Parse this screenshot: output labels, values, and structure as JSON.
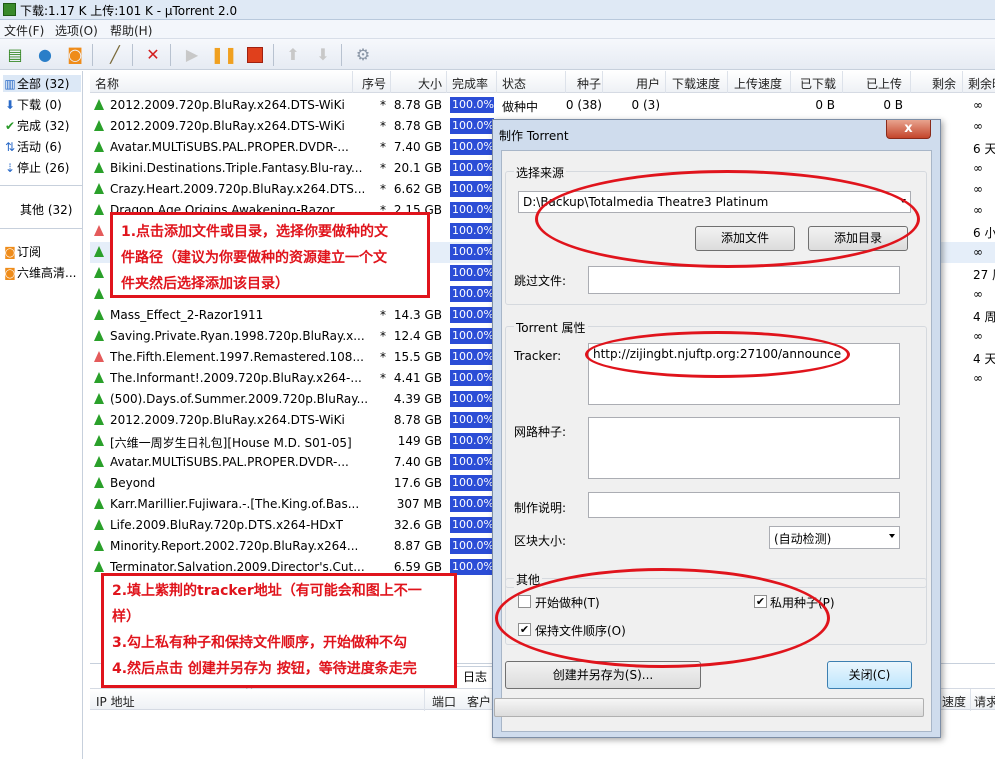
{
  "window": {
    "title": "下载:1.17 K 上传:101 K - µTorrent 2.0"
  },
  "menu": [
    "文件(F)",
    "选项(O)",
    "帮助(H)"
  ],
  "toolbar": {
    "icons": [
      "add-torrent-icon",
      "add-url-icon",
      "rss-icon",
      "create-torrent-icon",
      "remove-icon",
      "start-icon",
      "pause-icon",
      "stop-icon",
      "move-up-icon",
      "move-down-icon",
      "preferences-icon"
    ]
  },
  "sidebar": {
    "items": [
      {
        "label": "全部 (32)",
        "icon": "all-icon"
      },
      {
        "label": "下载 (0)",
        "icon": "download-icon"
      },
      {
        "label": "完成 (32)",
        "icon": "check-icon"
      },
      {
        "label": "活动 (6)",
        "icon": "active-icon"
      },
      {
        "label": "停止 (26)",
        "icon": "stopped-icon"
      }
    ],
    "other": "其他 (32)",
    "feeds": [
      {
        "label": "订阅",
        "icon": "rss-icon"
      },
      {
        "label": "六维高清...",
        "icon": "rss-icon"
      }
    ]
  },
  "columns": [
    "名称",
    "序号",
    "大小",
    "完成率",
    "状态",
    "种子",
    "用户",
    "下载速度",
    "上传速度",
    "已下载",
    "已上传",
    "剩余",
    "剩余时"
  ],
  "rows": [
    {
      "name": "2012.2009.720p.BluRay.x264.DTS-WiKi",
      "star": "*",
      "size": "8.78 GB",
      "pct": "100.0%",
      "status": "做种中",
      "seeds": "0 (38)",
      "peers": "0 (3)",
      "downloaded": "0 B",
      "uploaded": "0 B",
      "remain": "∞"
    },
    {
      "name": "2012.2009.720p.BluRay.x264.DTS-WiKi",
      "star": "*",
      "size": "8.78 GB",
      "pct": "100.0%",
      "remain": "∞"
    },
    {
      "name": "Avatar.MULTiSUBS.PAL.PROPER.DVDR-...",
      "star": "*",
      "size": "7.40 GB",
      "pct": "100.0%",
      "remain": "6 天"
    },
    {
      "name": "Bikini.Destinations.Triple.Fantasy.Blu-ray...",
      "star": "*",
      "size": "20.1 GB",
      "pct": "100.0%",
      "remain": "∞"
    },
    {
      "name": "Crazy.Heart.2009.720p.BluRay.x264.DTS...",
      "star": "*",
      "size": "6.62 GB",
      "pct": "100.0%",
      "remain": "∞"
    },
    {
      "name": "Dragon.Age.Origins.Awakening-Razor...",
      "star": "*",
      "size": "2.15 GB",
      "pct": "100.0%",
      "remain": "∞"
    },
    {
      "name": "",
      "star": "",
      "size": "",
      "pct": "100.0%",
      "remain": "6 小时"
    },
    {
      "name": "",
      "star": "",
      "size": "",
      "pct": "100.0%",
      "remain": "∞"
    },
    {
      "name": "",
      "star": "",
      "size": "",
      "pct": "100.0%",
      "remain": "27 周"
    },
    {
      "name": "",
      "star": "",
      "size": "",
      "pct": "100.0%",
      "remain": "∞"
    },
    {
      "name": "Mass_Effect_2-Razor1911",
      "star": "*",
      "size": "14.3 GB",
      "pct": "100.0%",
      "remain": "4 周"
    },
    {
      "name": "Saving.Private.Ryan.1998.720p.BluRay.x...",
      "star": "*",
      "size": "12.4 GB",
      "pct": "100.0%",
      "remain": "∞"
    },
    {
      "name": "The.Fifth.Element.1997.Remastered.108...",
      "star": "*",
      "size": "15.5 GB",
      "pct": "100.0%",
      "remain": "4 天"
    },
    {
      "name": "The.Informant!.2009.720p.BluRay.x264-...",
      "star": "*",
      "size": "4.41 GB",
      "pct": "100.0%",
      "remain": "∞"
    },
    {
      "name": "(500).Days.of.Summer.2009.720p.BluRay...",
      "star": "",
      "size": "4.39 GB",
      "pct": "100.0%",
      "remain": ""
    },
    {
      "name": "2012.2009.720p.BluRay.x264.DTS-WiKi",
      "star": "",
      "size": "8.78 GB",
      "pct": "100.0%",
      "remain": ""
    },
    {
      "name": "[六维一周岁生日礼包][House M.D. S01-05]",
      "star": "",
      "size": "149 GB",
      "pct": "100.0%",
      "remain": ""
    },
    {
      "name": "Avatar.MULTiSUBS.PAL.PROPER.DVDR-...",
      "star": "",
      "size": "7.40 GB",
      "pct": "100.0%",
      "remain": ""
    },
    {
      "name": "Beyond",
      "star": "",
      "size": "17.6 GB",
      "pct": "100.0%",
      "remain": ""
    },
    {
      "name": "Karr.Marillier.Fujiwara.-.[The.King.of.Bas...",
      "star": "",
      "size": "307 MB",
      "pct": "100.0%",
      "remain": ""
    },
    {
      "name": "Life.2009.BluRay.720p.DTS.x264-HDxT",
      "star": "",
      "size": "32.6 GB",
      "pct": "100.0%",
      "remain": ""
    },
    {
      "name": "Minority.Report.2002.720p.BluRay.x264...",
      "star": "",
      "size": "8.87 GB",
      "pct": "100.0%",
      "remain": ""
    },
    {
      "name": "Terminator.Salvation.2009.Director's.Cut...",
      "star": "",
      "size": "6.59 GB",
      "pct": "100.0%",
      "remain": ""
    }
  ],
  "bottom": {
    "tab_log": "日志",
    "ip_col": "IP 地址",
    "port_col": "端口",
    "client_col": "客户",
    "speed_col": "速度",
    "request_col": "请求"
  },
  "dialog": {
    "title": "制作 Torrent",
    "close": "x",
    "source_group": "选择来源",
    "source_path": "D:\\Backup\\Totalmedia Theatre3 Platinum",
    "add_file": "添加文件",
    "add_dir": "添加目录",
    "skip_label": "跳过文件:",
    "props_group": "Torrent 属性",
    "tracker_label": "Tracker:",
    "tracker_value": "http://zijingbt.njuftp.org:27100/announce",
    "webseed_label": "网路种子:",
    "comment_label": "制作说明:",
    "piece_label": "区块大小:",
    "piece_value": "(自动检测)",
    "other_group": "其他",
    "start_seed": "开始做种(T)",
    "private": "私用种子(P)",
    "keep_order": "保持文件顺序(O)",
    "create_btn": "创建并另存为(S)...",
    "close_btn": "关闭(C)"
  },
  "annotations": {
    "note1_line1": "1.点击添加文件或目录，选择你要做种的文",
    "note1_line2": "件路径（建议为你要做种的资源建立一个文",
    "note1_line3": "件夹然后选择添加该目录）",
    "note2_line1": "2.填上紫荆的tracker地址（有可能会和图上不一",
    "note2_line2": "样）",
    "note2_line3": "3.勾上私有种子和保持文件顺序，开始做种不勾",
    "note2_line4": "4.然后点击 创建并另存为 按钮，等待进度条走完"
  }
}
